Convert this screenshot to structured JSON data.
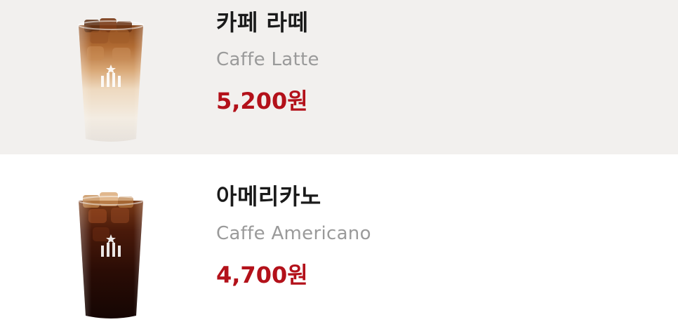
{
  "menu": {
    "items": [
      {
        "name_ko": "카페 라떼",
        "name_en": "Caffe Latte",
        "price": "5,200원",
        "image": "iced-latte-cup"
      },
      {
        "name_ko": "아메리카노",
        "name_en": "Caffe Americano",
        "price": "4,700원",
        "image": "iced-americano-cup"
      }
    ]
  },
  "colors": {
    "price": "#b3111a",
    "name": "#1a1a1a",
    "subname": "#9a9a9a",
    "highlight_bg": "#f2f0ee"
  }
}
